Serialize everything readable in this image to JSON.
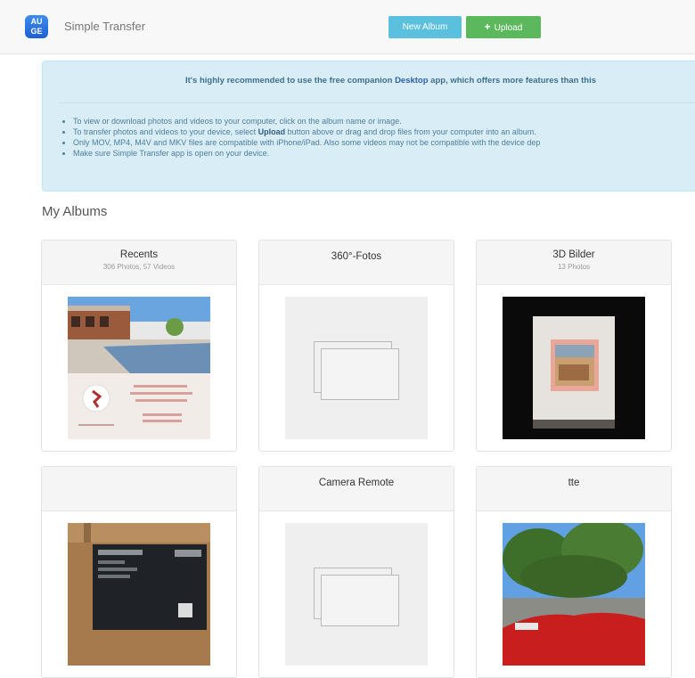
{
  "app": {
    "icon_text": "AU\nGE",
    "title": "Simple Transfer"
  },
  "toolbar": {
    "new_album_label": "New Album",
    "upload_label": "Upload"
  },
  "info": {
    "lead_before": "It's highly recommended to use the free companion ",
    "lead_link": "Desktop",
    "lead_after": " app, which offers more features than this",
    "bullets": [
      {
        "text": "To view or download photos and videos to your computer, click on the album name or image."
      },
      {
        "before": "To transfer photos and videos to your device, select ",
        "bold": "Upload",
        "after": " button above or drag and drop files from your computer into an album."
      },
      {
        "text": "Only MOV, MP4, M4V and MKV files are compatible with iPhone/iPad. Also some videos may not be compatible with the device dep"
      },
      {
        "text": "Make sure Simple Transfer app is open on your device."
      }
    ]
  },
  "section_title": "My Albums",
  "albums": [
    {
      "title": "Recents",
      "subtitle": "306 Photos, 57 Videos"
    },
    {
      "title": "360°-Fotos",
      "subtitle": ""
    },
    {
      "title": "3D Bilder",
      "subtitle": "13 Photos"
    },
    {
      "title": "",
      "subtitle": ""
    },
    {
      "title": "Camera Remote",
      "subtitle": ""
    },
    {
      "title": "tte",
      "subtitle": ""
    }
  ],
  "colors": {
    "info_bg": "#d9edf7",
    "new_album_btn": "#5bc0de",
    "upload_btn": "#5cb85c",
    "app_icon": "#2f7be6"
  },
  "icons": {
    "upload": "plus-icon",
    "app": "app-icon",
    "placeholder": "album-placeholder-icon"
  }
}
